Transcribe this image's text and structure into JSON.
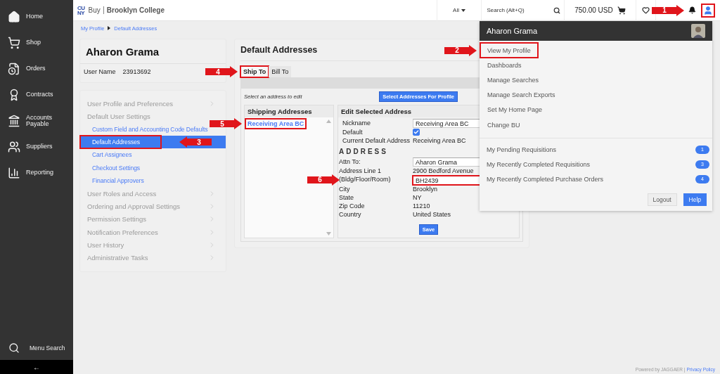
{
  "sidebar": {
    "items": [
      {
        "label": "Home"
      },
      {
        "label": "Shop"
      },
      {
        "label": "Orders"
      },
      {
        "label": "Contracts"
      },
      {
        "label": "Accounts Payable"
      },
      {
        "label": "Suppliers"
      },
      {
        "label": "Reporting"
      }
    ],
    "menu_search": "Menu Search",
    "collapse": "←"
  },
  "topbar": {
    "logo_lines": [
      "CU",
      "NY"
    ],
    "brand_prefix": "Buy",
    "brand": "Brooklyn College",
    "scope": "All",
    "search": {
      "placeholder": "Search (Alt+Q)"
    },
    "cart_total": "750.00 USD",
    "notifications": {
      "callout": {
        "label": "1",
        "pointing_left": false
      }
    },
    "user_button": {
      "highlighted": true
    }
  },
  "breadcrumb": [
    "My Profile",
    "Default Addresses"
  ],
  "profile": {
    "name": "Aharon Grama",
    "user_name_label": "User Name",
    "user_name": "23913692"
  },
  "settings_menu": [
    {
      "label": "User Profile and Preferences",
      "expanded": false
    },
    {
      "label": "Default User Settings",
      "expanded": true,
      "children": [
        {
          "label": "Custom Field and Accounting Code Defaults",
          "selected": false,
          "highlighted": false
        },
        {
          "label": "Default Addresses",
          "selected": true,
          "highlighted": true,
          "callout": {
            "label": "3",
            "pointing_left": true
          }
        },
        {
          "label": "Cart Assignees",
          "selected": false,
          "highlighted": false
        },
        {
          "label": "Checkout Settings",
          "selected": false,
          "highlighted": false
        },
        {
          "label": "Financial Approvers",
          "selected": false,
          "highlighted": false
        }
      ]
    },
    {
      "label": "User Roles and Access",
      "expanded": false
    },
    {
      "label": "Ordering and Approval Settings",
      "expanded": false
    },
    {
      "label": "Permission Settings",
      "expanded": false
    },
    {
      "label": "Notification Preferences",
      "expanded": false
    },
    {
      "label": "User History",
      "expanded": false
    },
    {
      "label": "Administrative Tasks",
      "expanded": false
    }
  ],
  "main": {
    "title": "Default Addresses",
    "tabs": [
      {
        "label": "Ship To",
        "selected": true,
        "highlighted": true,
        "callout": {
          "label": "4",
          "pointing_left": false
        }
      },
      {
        "label": "Bill To",
        "selected": false,
        "highlighted": false
      }
    ],
    "hint": "Select an address to edit",
    "select_button": "Select Addresses For Profile",
    "addresses": {
      "title": "Shipping Addresses",
      "items": [
        {
          "label": "Receiving Area BC",
          "selected": true,
          "highlighted": true,
          "callout": {
            "label": "5",
            "pointing_left": false
          }
        }
      ]
    },
    "edit": {
      "title": "Edit Selected Address",
      "rows": [
        {
          "kind": "field",
          "label": "Nickname",
          "value": "Receiving Area BC",
          "highlighted": false
        },
        {
          "kind": "checkbox",
          "label": "Default",
          "checked": true
        },
        {
          "kind": "text",
          "label": "Current Default Address",
          "value": "Receiving Area BC"
        },
        {
          "kind": "section",
          "label": "ADDRESS"
        },
        {
          "kind": "field",
          "label": "Attn To:",
          "value": "Aharon Grama",
          "highlighted": false
        },
        {
          "kind": "text",
          "label": "Address Line 1",
          "value": "2900 Bedford Avenue"
        },
        {
          "kind": "field",
          "label": "(Bldg/Floor/Room)",
          "value": "BH2439",
          "highlighted": true,
          "callout": {
            "label": "6",
            "pointing_left": false
          }
        },
        {
          "kind": "text",
          "label": "City",
          "value": "Brooklyn"
        },
        {
          "kind": "text",
          "label": "State",
          "value": "NY"
        },
        {
          "kind": "text",
          "label": "Zip Code",
          "value": "11210"
        },
        {
          "kind": "text",
          "label": "Country",
          "value": "United States"
        }
      ],
      "save": "Save"
    }
  },
  "dropdown": {
    "name": "Aharon Grama",
    "links": [
      {
        "label": "View My Profile",
        "highlighted": true,
        "callout": {
          "label": "2",
          "pointing_left": false
        }
      },
      {
        "label": "Dashboards",
        "highlighted": false
      },
      {
        "label": "Manage Searches",
        "highlighted": false
      },
      {
        "label": "Manage Search Exports",
        "highlighted": false
      },
      {
        "label": "Set My Home Page",
        "highlighted": false
      },
      {
        "label": "Change BU",
        "highlighted": false
      }
    ],
    "counters": [
      {
        "label": "My Pending Requisitions",
        "count": "1"
      },
      {
        "label": "My Recently Completed Requisitions",
        "count": "3"
      },
      {
        "label": "My Recently Completed Purchase Orders",
        "count": "4"
      }
    ],
    "buttons": [
      {
        "label": "Logout",
        "kind": "secondary"
      },
      {
        "label": "Help",
        "kind": "primary"
      }
    ]
  },
  "footer": {
    "text": "Powered by JAGGAER |",
    "link": "Privacy Policy"
  }
}
